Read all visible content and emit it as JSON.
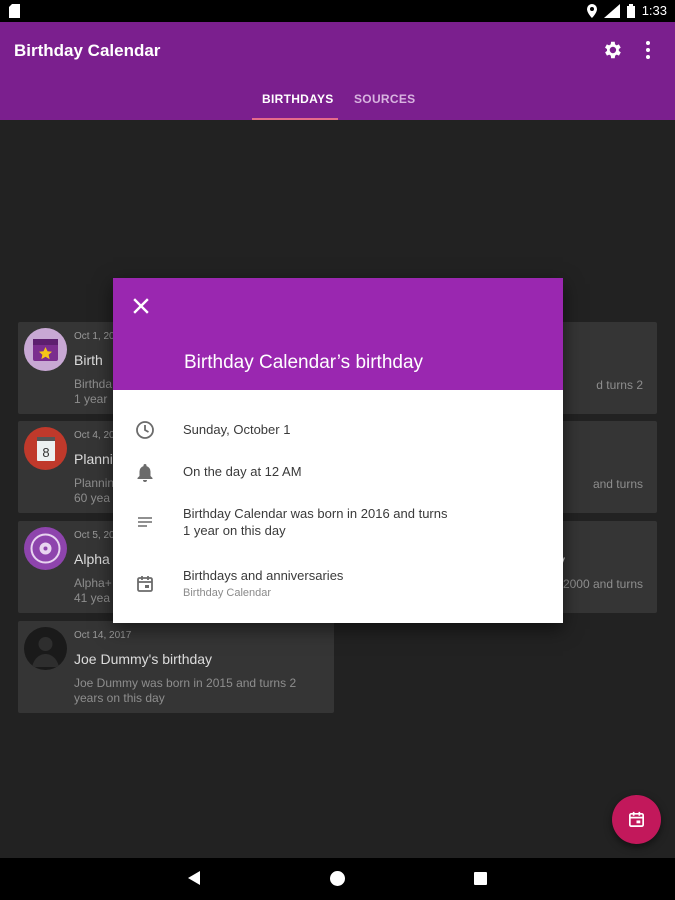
{
  "status_bar": {
    "time": "1:33",
    "network": "LTE"
  },
  "app_bar": {
    "title": "Birthday Calendar",
    "tabs": [
      {
        "label": "BIRTHDAYS",
        "active": true
      },
      {
        "label": "SOURCES",
        "active": false
      }
    ]
  },
  "cards": [
    {
      "date": "Oct 1, 20",
      "name": "Birth",
      "desc": "Birthda\n1 year",
      "right_desc": "d turns 2",
      "avatar": "calendar-star-icon"
    },
    {
      "date": "Oct 4, 20",
      "name": "Planni",
      "desc": "Plannin\n60 yea",
      "right_desc": "and turns",
      "avatar": "flip-calendar-icon"
    },
    {
      "date": "Oct 5, 20",
      "name": "Alpha",
      "desc": "Alpha+\n41 yea",
      "right_desc": "2000 and turns",
      "right_name": "y",
      "avatar": "disc-icon"
    },
    {
      "date": "Oct 14, 2017",
      "name": "Joe Dummy's birthday",
      "desc": "Joe Dummy was born in 2015 and turns 2\nyears on this day",
      "avatar": "person-photo-icon"
    }
  ],
  "dialog": {
    "title": "Birthday Calendar’s birthday",
    "rows": [
      {
        "icon": "clock-icon",
        "text": "Sunday, October 1"
      },
      {
        "icon": "bell-icon",
        "text": "On the day at 12 AM"
      },
      {
        "icon": "notes-icon",
        "text": "Birthday Calendar was born in 2016 and turns\n1 year on this day"
      },
      {
        "icon": "calendar-icon",
        "text": "Birthdays and anniversaries",
        "subtext": "Birthday Calendar"
      }
    ]
  },
  "colors": {
    "app_bar": "#7b1f8e",
    "dialog_header": "#9a27b0",
    "accent": "#c2185b",
    "tab_indicator": "#e66b8a"
  }
}
